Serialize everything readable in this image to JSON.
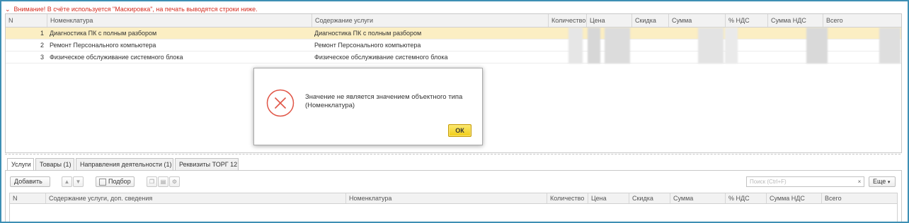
{
  "warning": "Внимание! В счёте используется \"Маскировка\", на печать выводятся строки ниже.",
  "upper_table": {
    "columns": [
      "N",
      "Номенклатура",
      "Содержание услуги",
      "Количество",
      "Цена",
      "Скидка",
      "Сумма",
      "% НДС",
      "Сумма НДС",
      "Всего"
    ],
    "rows": [
      {
        "n": "1",
        "nomenclature": "Диагностика ПК с полным разбором",
        "content": "Диагностика ПК с полным разбором"
      },
      {
        "n": "2",
        "nomenclature": "Ремонт Персонального компьютера",
        "content": "Ремонт Персонального компьютера"
      },
      {
        "n": "3",
        "nomenclature": "Физическое обслуживание системного блока",
        "content": "Физическое обслуживание системного блока"
      }
    ]
  },
  "tabs": [
    "Услуги",
    "Товары (1)",
    "Направления деятельности (1)",
    "Реквизиты ТОРГ 12"
  ],
  "toolbar": {
    "add_label": "Добавить",
    "pick_label": "Подбор",
    "search_placeholder": "Поиск (Ctrl+F)",
    "search_clear": "×",
    "more_label": "Еще"
  },
  "lower_table": {
    "columns": [
      "N",
      "Содержание услуги, доп. сведения",
      "Номенклатура",
      "Количество",
      "Цена",
      "Скидка",
      "Сумма",
      "% НДС",
      "Сумма НДС",
      "Всего"
    ]
  },
  "dialog": {
    "message_line1": "Значение не является значением объектного типа",
    "message_line2": "(Номенклатура)",
    "ok_label": "ОК"
  },
  "colors": {
    "frame": "#3d8fb4",
    "warning_text": "#d52b1e",
    "selected_row": "#fbeec3",
    "ok_button": "#f1cd15",
    "error_icon": "#e05546"
  }
}
